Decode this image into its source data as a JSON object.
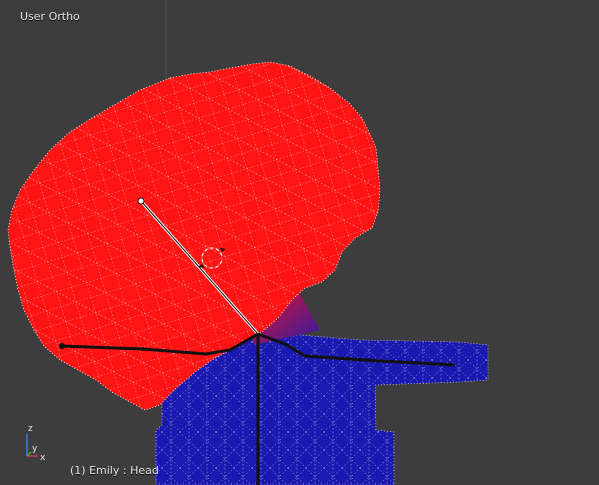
{
  "viewport": {
    "view_label": "User Ortho",
    "object_info": "(1) Emily : Head"
  },
  "axes": {
    "z_label": "z",
    "y_label": "y",
    "x_label": "x"
  },
  "colors": {
    "background": "#3d3d3d",
    "selected_mesh": "#ff1a1a",
    "weight_mesh": "#1a1aa8",
    "wire": "#ffffff",
    "bone": "#111111"
  }
}
